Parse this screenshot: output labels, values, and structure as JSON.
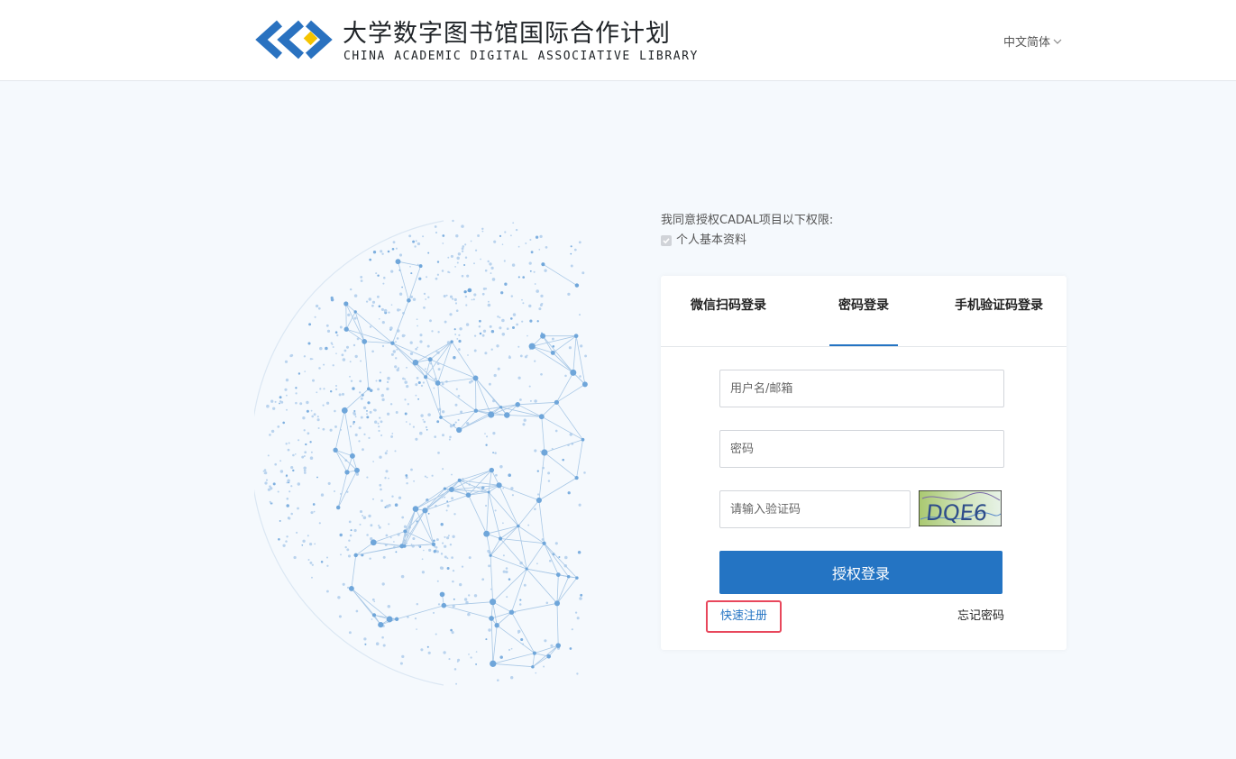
{
  "header": {
    "logo_title": "大学数字图书馆国际合作计划",
    "logo_subtitle": "CHINA ACADEMIC DIGITAL ASSOCIATIVE LIBRARY",
    "language": "中文简体"
  },
  "consent": {
    "title": "我同意授权CADAL项目以下权限:",
    "item": "个人基本资料"
  },
  "login": {
    "tabs": [
      "微信扫码登录",
      "密码登录",
      "手机验证码登录"
    ],
    "active_tab": "密码登录",
    "username_placeholder": "用户名/邮箱",
    "password_placeholder": "密码",
    "captcha_placeholder": "请输入验证码",
    "captcha_text": "DQE6",
    "submit_label": "授权登录",
    "register_link": "快速注册",
    "forgot_link": "忘记密码"
  },
  "colors": {
    "primary": "#2474c3",
    "highlight_border": "#e8475c",
    "logo_blue": "#2a72c0",
    "logo_yellow": "#f5c400"
  }
}
